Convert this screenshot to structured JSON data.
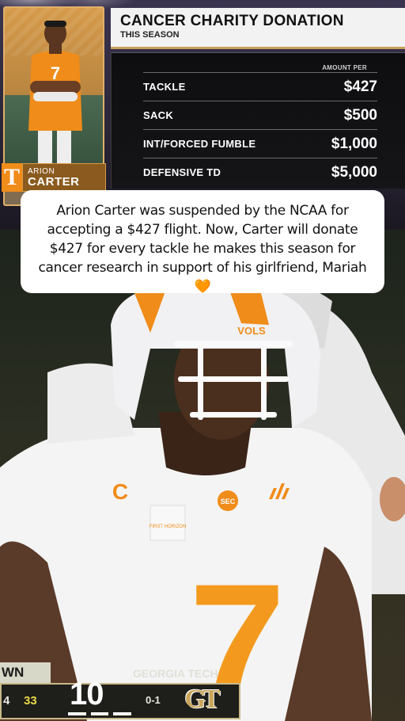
{
  "graphic": {
    "title": "CANCER CHARITY DONATION",
    "subtitle": "THIS SEASON",
    "column_header": "AMOUNT PER",
    "rows": [
      {
        "label": "TACKLE",
        "value": "$427"
      },
      {
        "label": "SACK",
        "value": "$500"
      },
      {
        "label": "INT/FORCED FUMBLE",
        "value": "$1,000"
      },
      {
        "label": "DEFENSIVE TD",
        "value": "$5,000"
      }
    ],
    "player": {
      "first_name": "ARION",
      "last_name": "CARTER",
      "team_logo": "T",
      "jersey_number": "7"
    }
  },
  "caption": {
    "text": "Arion Carter was suspended by the NCAA for accepting a $427 flight. Now, Carter will donate $427 for every tackle he makes this season for cancer research in support of his girlfriend, Mariah",
    "emoji": "🧡"
  },
  "photo": {
    "jersey_number": "7",
    "captain_patch": "C",
    "sponsor_patch": "FIRST HORIZON",
    "conference_patch": "SEC",
    "helmet_text": "VOLS"
  },
  "scoreboard": {
    "left_label": "WN",
    "left_score": "4",
    "timeouts_value": "33",
    "team_name": "GEORGIA TECH",
    "team_score": "10",
    "team_record": "0-1",
    "team_logo": "GT"
  },
  "colors": {
    "tennessee_orange": "#f08c1a",
    "gold": "#c9a15a"
  }
}
